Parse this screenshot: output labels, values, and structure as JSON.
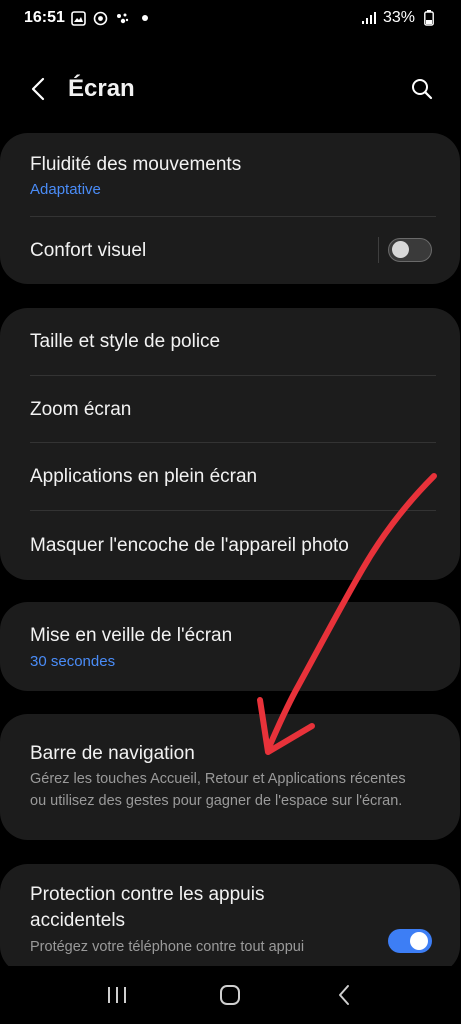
{
  "status_bar": {
    "time": "16:51",
    "battery": "33%"
  },
  "header": {
    "title": "Écran"
  },
  "card1": {
    "motion_title": "Fluidité des mouvements",
    "motion_value": "Adaptative",
    "comfort_title": "Confort visuel",
    "comfort_enabled": false
  },
  "card2": {
    "font_title": "Taille et style de police",
    "zoom_title": "Zoom écran",
    "fullscreen_title": "Applications en plein écran",
    "cutout_title": "Masquer l'encoche de l'appareil photo"
  },
  "card3": {
    "timeout_title": "Mise en veille de l'écran",
    "timeout_value": "30 secondes"
  },
  "card4": {
    "navbar_title": "Barre de navigation",
    "navbar_desc": "Gérez les touches Accueil, Retour et Applications récentes ou utilisez des gestes pour gagner de l'espace sur l'écran."
  },
  "card5": {
    "accidental_title": "Protection contre les appuis accidentels",
    "accidental_desc": "Protégez votre téléphone contre tout appui",
    "accidental_enabled": true
  },
  "colors": {
    "accent": "#4a8cf7",
    "annotation_arrow": "#e8323a",
    "card_bg": "#1c1c1c"
  }
}
